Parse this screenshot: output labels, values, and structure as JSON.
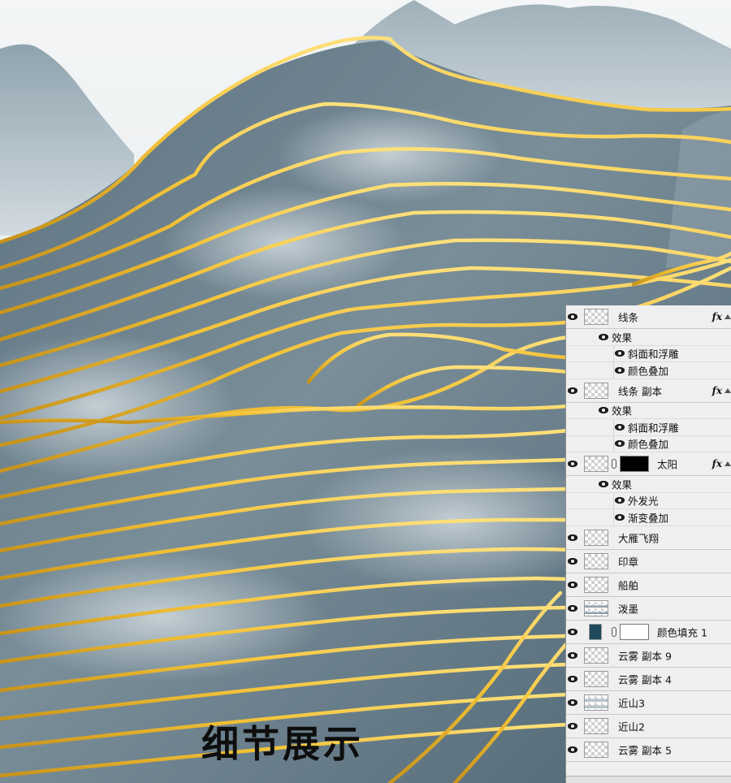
{
  "caption": "细节展示",
  "colors": {
    "sky": "#e4eaed",
    "mountain": "#556c79",
    "gold_line": "#f3c237",
    "panel_bg": "#efefef"
  },
  "layers_panel": {
    "rows": [
      {
        "type": "layer",
        "name": "线条",
        "fx": "fx",
        "thumb": "checker"
      },
      {
        "type": "effects",
        "name": "效果"
      },
      {
        "type": "effect",
        "name": "斜面和浮雕"
      },
      {
        "type": "effect",
        "name": "颜色叠加"
      },
      {
        "type": "layer",
        "name": "线条 副本",
        "fx": "fx",
        "thumb": "checker"
      },
      {
        "type": "effects",
        "name": "效果"
      },
      {
        "type": "effect",
        "name": "斜面和浮雕"
      },
      {
        "type": "effect",
        "name": "颜色叠加"
      },
      {
        "type": "layer",
        "name": "太阳",
        "fx": "fx",
        "thumb": "checker",
        "mask": "dark"
      },
      {
        "type": "effects",
        "name": "效果"
      },
      {
        "type": "effect",
        "name": "外发光"
      },
      {
        "type": "effect",
        "name": "渐变叠加"
      },
      {
        "type": "layer",
        "name": "大雁飞翔",
        "thumb": "checker"
      },
      {
        "type": "layer",
        "name": "印章",
        "thumb": "checker"
      },
      {
        "type": "layer",
        "name": "船舶",
        "thumb": "checker"
      },
      {
        "type": "layer",
        "name": "泼墨",
        "thumb": "ink"
      },
      {
        "type": "layer",
        "name": "颜色填充 1",
        "thumb": "swatch",
        "mask": "light"
      },
      {
        "type": "layer",
        "name": "云雾 副本 9",
        "thumb": "checker"
      },
      {
        "type": "layer",
        "name": "云雾 副本 4",
        "thumb": "checker"
      },
      {
        "type": "layer",
        "name": "近山3",
        "thumb": "hill"
      },
      {
        "type": "layer",
        "name": "近山2",
        "thumb": "checker"
      },
      {
        "type": "layer",
        "name": "云雾 副本 5",
        "thumb": "checker"
      }
    ]
  }
}
